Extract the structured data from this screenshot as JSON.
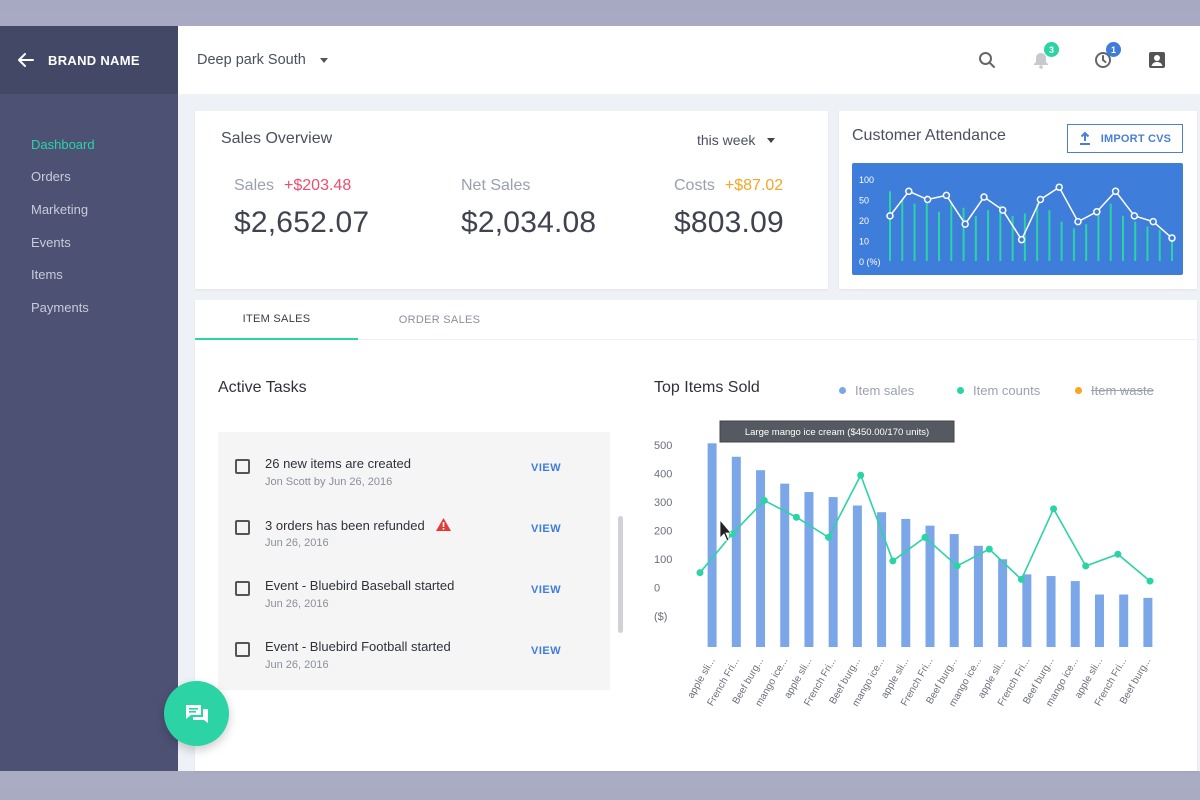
{
  "sidebar": {
    "brand": "BRAND NAME",
    "items": [
      {
        "label": "Dashboard",
        "active": true
      },
      {
        "label": "Orders"
      },
      {
        "label": "Marketing"
      },
      {
        "label": "Events"
      },
      {
        "label": "Items"
      },
      {
        "label": "Payments"
      }
    ]
  },
  "topbar": {
    "location": "Deep park South",
    "notifications_count": "3",
    "alerts_count": "1"
  },
  "sales_overview": {
    "title": "Sales Overview",
    "period": "this week",
    "metrics": [
      {
        "label": "Sales",
        "delta": "+$203.48",
        "value": "$2,652.07",
        "delta_color": "#ef4d6b"
      },
      {
        "label": "Net Sales",
        "delta": "",
        "value": "$2,034.08"
      },
      {
        "label": "Costs",
        "delta": "+$87.02",
        "value": "$803.09",
        "delta_color": "#f5a623"
      }
    ]
  },
  "attendance": {
    "title": "Customer Attendance",
    "import_label": "IMPORT CVS"
  },
  "tabs": [
    "ITEM SALES",
    "ORDER SALES"
  ],
  "tasks": {
    "title": "Active Tasks",
    "view_label": "VIEW",
    "items": [
      {
        "title": "26 new items are created",
        "sub": "Jon Scott by Jun 26, 2016",
        "warning": false
      },
      {
        "title": "3 orders has been refunded",
        "sub": "Jun 26, 2016",
        "warning": true
      },
      {
        "title": "Event - Bluebird Baseball started",
        "sub": "Jun 26, 2016",
        "warning": false
      },
      {
        "title": "Event - Bluebird Football started",
        "sub": "Jun 26, 2016",
        "warning": false
      }
    ]
  },
  "top_items": {
    "title": "Top Items Sold",
    "legend": [
      {
        "label": "Item sales",
        "color": "#7ba7e8"
      },
      {
        "label": "Item counts",
        "color": "#2bd3a5"
      },
      {
        "label": "Item waste",
        "color": "#f5a623",
        "struck": true
      }
    ],
    "tooltip": "Large mango ice cream ($450.00/170 units)"
  },
  "colors": {
    "accent": "#2bd3a5",
    "primary": "#3f7ddb",
    "sidebar": "#4d5275"
  },
  "chart_data": [
    {
      "type": "line",
      "title": "Customer Attendance",
      "y_ticks": [
        "100",
        "50",
        "20",
        "10",
        "0 (%)"
      ],
      "series": [
        {
          "values": [
            55,
            85,
            75,
            80,
            45,
            78,
            62,
            26,
            75,
            90,
            48,
            60,
            85,
            55,
            48,
            28
          ]
        }
      ],
      "bar_series": [
        {
          "values": [
            85,
            75,
            70,
            80,
            60,
            72,
            65,
            55,
            62,
            68,
            55,
            58,
            70,
            62,
            48,
            40,
            45,
            60,
            70,
            55,
            48,
            42,
            38,
            30
          ]
        }
      ]
    },
    {
      "type": "bar",
      "title": "Top Items Sold",
      "y_ticks": [
        "500",
        "400",
        "300",
        "200",
        "100",
        "0",
        "($)"
      ],
      "categories": [
        "apple sli...",
        "French Fri...",
        "Beef burg...",
        "mango ice...",
        "apple sli...",
        "French Fri...",
        "Beef burg...",
        "mango ice...",
        "apple sli...",
        "French Fri...",
        "Beef burg...",
        "mango ice...",
        "apple sli...",
        "French Fri...",
        "Beef burg...",
        "mango ice...",
        "apple sli...",
        "French Fri...",
        "Beef burg..."
      ],
      "series": [
        {
          "name": "Item sales",
          "type": "bar",
          "values": [
            505,
            465,
            425,
            385,
            360,
            345,
            320,
            300,
            280,
            260,
            235,
            200,
            160,
            115,
            110,
            95,
            55,
            55,
            45
          ]
        },
        {
          "name": "Item counts",
          "type": "line",
          "values": [
            120,
            235,
            335,
            285,
            225,
            410,
            155,
            225,
            140,
            190,
            100,
            310,
            140,
            175,
            95
          ]
        }
      ]
    }
  ]
}
